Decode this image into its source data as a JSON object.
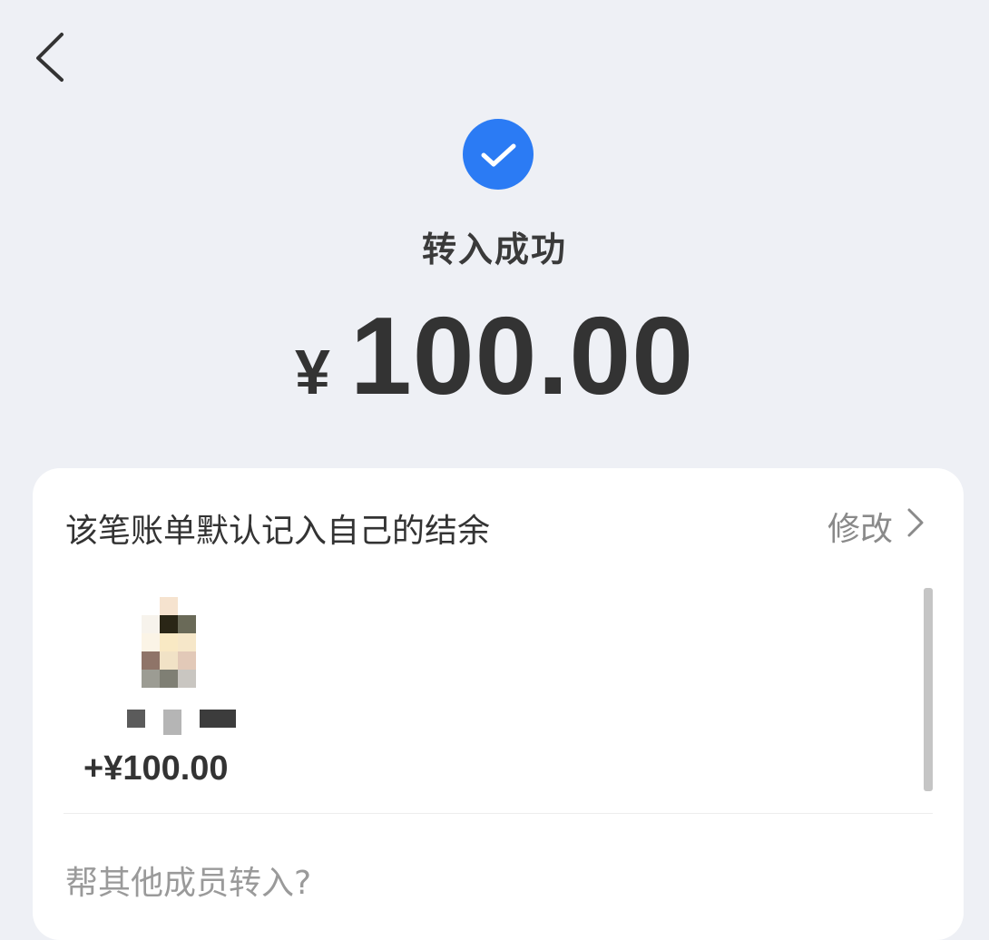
{
  "nav": {
    "back_icon": "chevron-left-icon"
  },
  "status": {
    "icon": "check-circle-icon",
    "icon_color": "#2B7BF4",
    "title": "转入成功"
  },
  "amount": {
    "currency": "¥",
    "value": "100.00"
  },
  "card": {
    "header_text": "该笔账单默认记入自己的结余",
    "modify_label": "修改",
    "modify_icon": "chevron-right-icon",
    "member": {
      "amount": "+¥100.00"
    },
    "help_transfer_label": "帮其他成员转入?"
  }
}
